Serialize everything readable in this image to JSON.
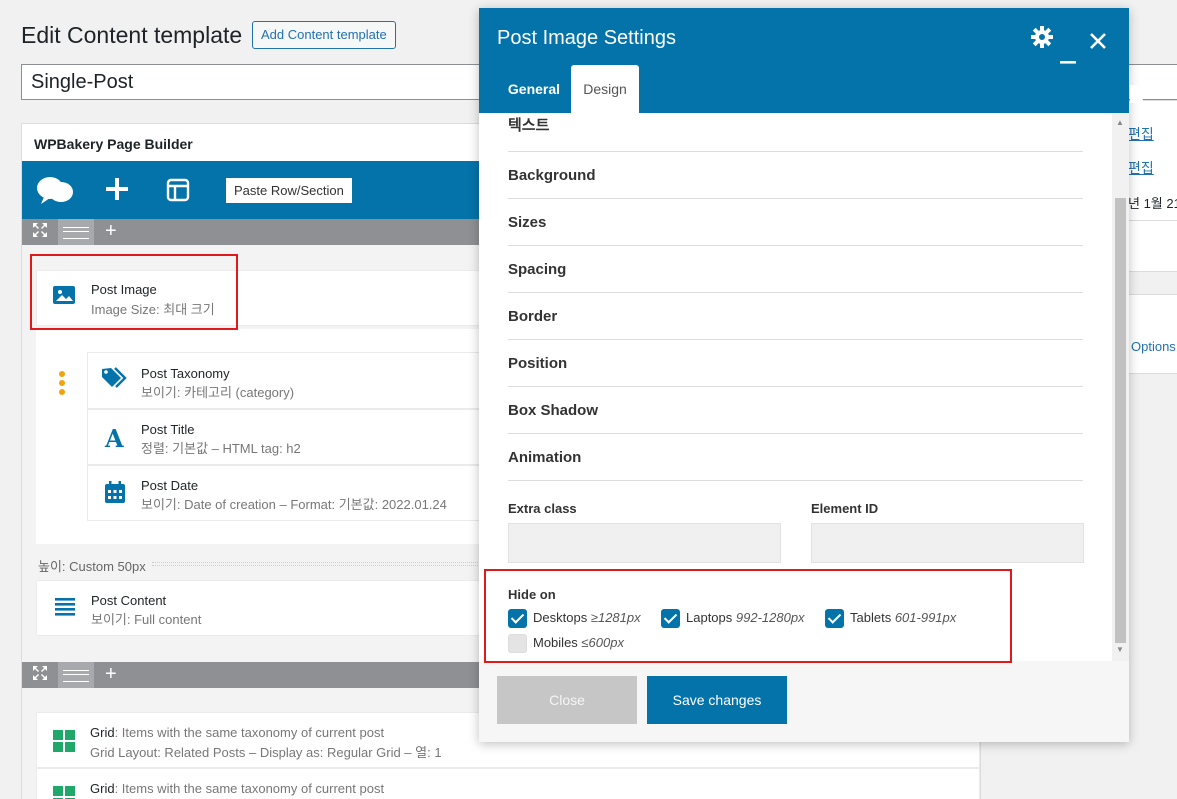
{
  "page": {
    "title": "Edit Content template",
    "add_button": "Add Content template",
    "post_title": "Single-Post"
  },
  "right_panel": {
    "link1": "편집",
    "link2": "편집",
    "date_fragment": "년 1월 21",
    "options_link": "Options"
  },
  "builder": {
    "title": "WPBakery Page Builder",
    "paste_label": "Paste Row/Section",
    "elements": {
      "post_image": {
        "title": "Post Image",
        "sub": "Image Size: 최대 크기"
      },
      "post_taxonomy": {
        "title": "Post Taxonomy",
        "sub": "보이기: 카테고리 (category)"
      },
      "post_title": {
        "title": "Post Title",
        "sub": "정렬: 기본값  – HTML tag: h2"
      },
      "post_date": {
        "title": "Post Date",
        "sub": "보이기: Date of creation  – Format: 기본값: 2022.01.24"
      },
      "spacer": "높이: Custom  50px",
      "post_content": {
        "title": "Post Content",
        "sub": "보이기: Full content"
      },
      "grid1": {
        "title_prefix": "Grid",
        "title_rest": ": Items with the same taxonomy of current post",
        "sub": "Grid Layout: Related Posts – Display as: Regular Grid – 열: 1"
      },
      "grid2": {
        "title_prefix": "Grid",
        "title_rest": ": Items with the same taxonomy of current post"
      }
    }
  },
  "modal": {
    "title": "Post Image Settings",
    "tabs": [
      "General",
      "Design"
    ],
    "active_tab": "Design",
    "sections": [
      "텍스트",
      "Background",
      "Sizes",
      "Spacing",
      "Border",
      "Position",
      "Box Shadow",
      "Animation"
    ],
    "extra_class_label": "Extra class",
    "extra_class_value": "",
    "element_id_label": "Element ID",
    "element_id_value": "",
    "hide_on_label": "Hide on",
    "hide_on": [
      {
        "label": "Desktops",
        "range": "≥1281px",
        "checked": true
      },
      {
        "label": "Laptops",
        "range": "992-1280px",
        "checked": true
      },
      {
        "label": "Tablets",
        "range": "601-991px",
        "checked": true
      },
      {
        "label": "Mobiles",
        "range": "≤600px",
        "checked": false
      }
    ],
    "close_label": "Close",
    "save_label": "Save changes"
  },
  "colors": {
    "accent": "#0473aa",
    "highlight": "#e0191d"
  }
}
